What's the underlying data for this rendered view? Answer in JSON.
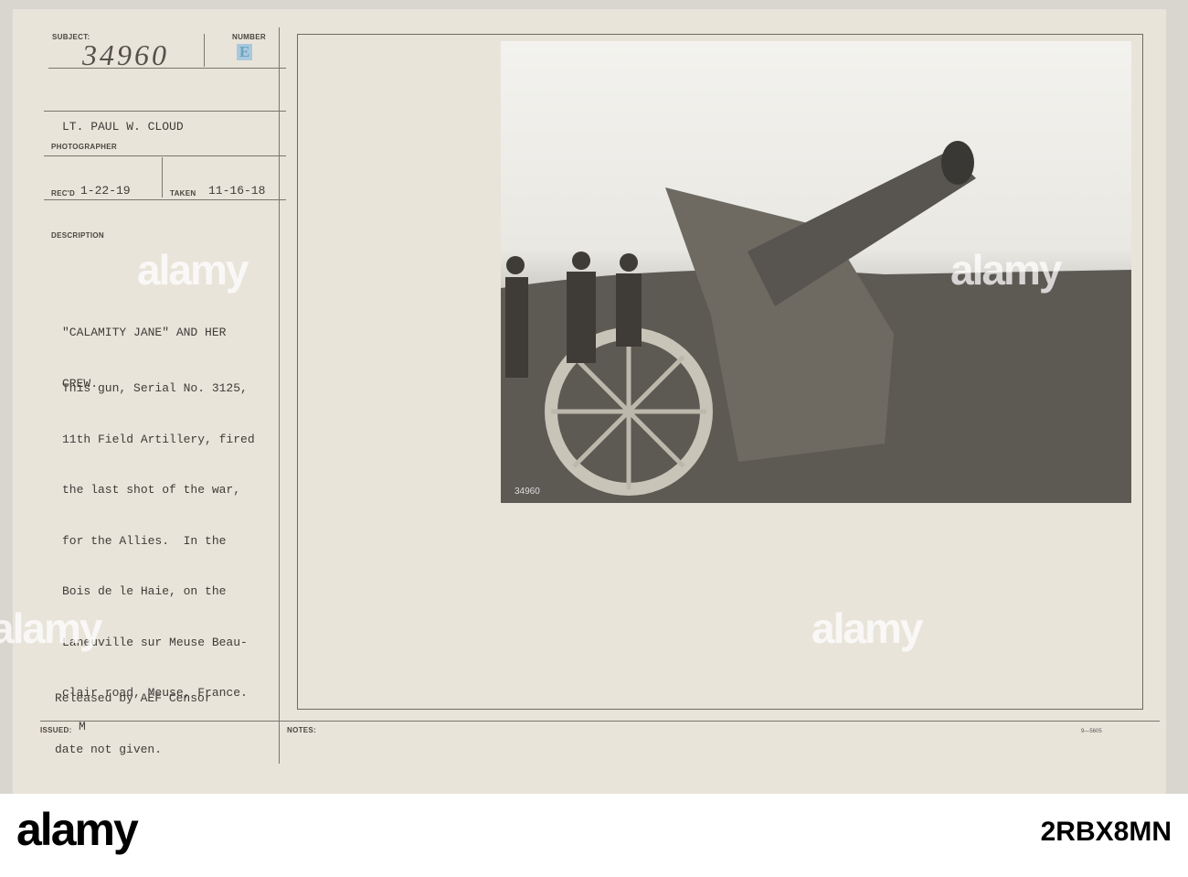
{
  "card": {
    "subject_label": "SUBJECT:",
    "subject_value": "34960",
    "number_label": "NUMBER",
    "number_value": "E",
    "photographer_value": "LT. PAUL W. CLOUD",
    "photographer_label": "PHOTOGRAPHER",
    "recd_label": "REC'D",
    "recd_value": "1-22-19",
    "taken_label": "TAKEN",
    "taken_value": "11-16-18",
    "description_label": "DESCRIPTION",
    "title_lines": [
      "\"CALAMITY JANE\" AND HER",
      "CREW."
    ],
    "body_lines": [
      "This gun, Serial No. 3125,",
      "11th Field Artillery, fired",
      "the last shot of the war,",
      "for the Allies.  In the",
      "Bois de le Haie, on the",
      "Laneuville sur Meuse Beau-",
      "clair road, Meuse, France."
    ],
    "censor_lines": [
      "Released by AEF Censor",
      "date not given."
    ],
    "issued_label": "ISSUED:",
    "issued_value": "M",
    "notes_label": "NOTES:",
    "form_code": "9—5605"
  },
  "photo": {
    "stamp_number": "34960",
    "subject": "field gun with crew"
  },
  "watermark": "alamy",
  "footer": {
    "logo": "alamy",
    "image_code": "2RBX8MN"
  }
}
